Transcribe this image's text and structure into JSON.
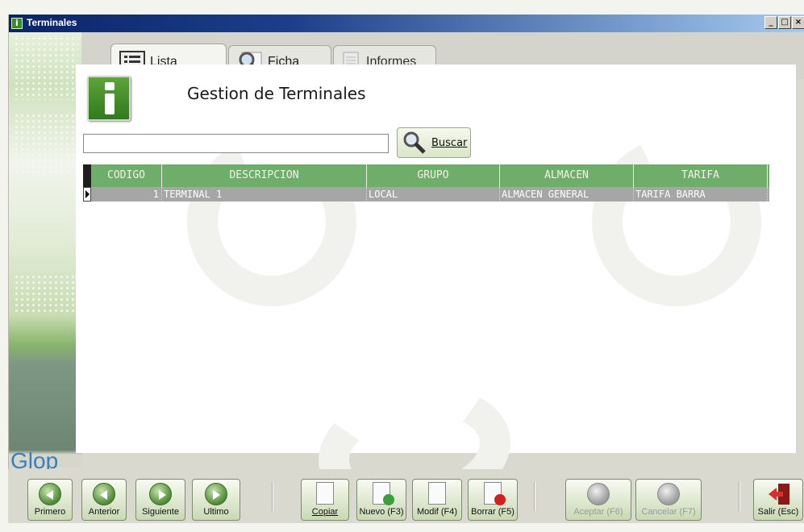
{
  "window": {
    "title": "Terminales",
    "controls": [
      "_",
      "□",
      "×"
    ]
  },
  "brand": "Glop",
  "tabs": [
    {
      "label": "Lista",
      "icon": "list-icon",
      "active": true
    },
    {
      "label": "Ficha",
      "icon": "magnifier-icon",
      "active": false
    },
    {
      "label": "Informes",
      "icon": "report-icon",
      "active": false
    }
  ],
  "page": {
    "title": "Gestion de Terminales"
  },
  "search": {
    "value": "",
    "button_label": "Buscar"
  },
  "grid": {
    "columns": [
      "CODIGO",
      "DESCRIPCION",
      "GRUPO",
      "ALMACEN",
      "TARIFA"
    ],
    "rows": [
      {
        "codigo": "1",
        "descripcion": "TERMINAL 1",
        "grupo": "LOCAL",
        "almacen": "ALMACEN GENERAL",
        "tarifa": "TARIFA BARRA"
      }
    ]
  },
  "toolbar": {
    "primero": "Primero",
    "anterior": "Anterior",
    "siguiente": "Siguiente",
    "ultimo": "Ultimo",
    "copiar": "Copiar",
    "nuevo": "Nuevo (F3)",
    "modif": "Modif (F4)",
    "borrar": "Borrar (F5)",
    "aceptar": "Aceptar (F6)",
    "cancelar": "Cancelar (F7)",
    "salir": "Salir (Esc)"
  },
  "colors": {
    "grid_header": "#6fae6a",
    "grid_row": "#a6a6a6",
    "accent_green": "#3a8a2a",
    "title_blue": "#0a246a",
    "brand_blue": "#3c7fb8"
  }
}
